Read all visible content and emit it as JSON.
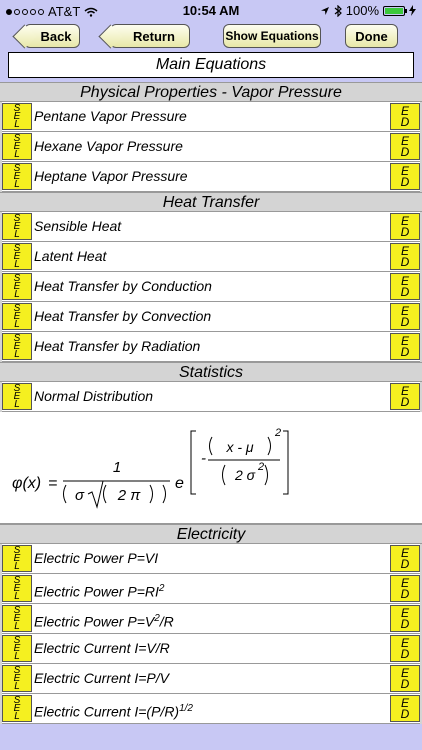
{
  "status_bar": {
    "carrier": "AT&T",
    "time": "10:54 AM",
    "battery_percent": "100%",
    "battery_level": 1.0
  },
  "toolbar": {
    "back_label": "Back",
    "return_label": "Return",
    "show_equations_label": "Show Equations",
    "done_label": "Done"
  },
  "page_title": "Main Equations",
  "tag_sel": [
    "S",
    "E",
    "L"
  ],
  "tag_ed": [
    "E",
    "D"
  ],
  "sections": [
    {
      "title": "Physical Properties - Vapor Pressure",
      "items": [
        "Pentane Vapor Pressure",
        "Hexane Vapor Pressure",
        "Heptane Vapor Pressure"
      ]
    },
    {
      "title": "Heat Transfer",
      "items": [
        "Sensible Heat",
        "Latent Heat",
        "Heat Transfer by Conduction",
        "Heat Transfer by Convection",
        "Heat Transfer by Radiation"
      ]
    },
    {
      "title": "Statistics",
      "items": [
        "Normal Distribution"
      ]
    },
    {
      "title": "Electricity",
      "items": [
        "Electric Power  P=VI",
        "Electric Power  P=RI",
        "Electric Power  P=V",
        "Electric Current  I=V/R",
        "Electric Current  I=P/V",
        "Electric Current  I=(P/R)"
      ]
    }
  ],
  "superscripts": {
    "power_ri": "2",
    "power_v": "2",
    "power_v_tail": "/R",
    "current_pr": "1/2"
  },
  "formula": {
    "lhs": "φ(x)",
    "equals": "=",
    "numerator": "1",
    "sigma": "σ",
    "two_pi": "2  π",
    "e": "e",
    "minus": "-",
    "x_minus_mu": "x  -  μ",
    "exp2": "2",
    "two_sigma": "2  σ",
    "sigma_exp": "2"
  }
}
